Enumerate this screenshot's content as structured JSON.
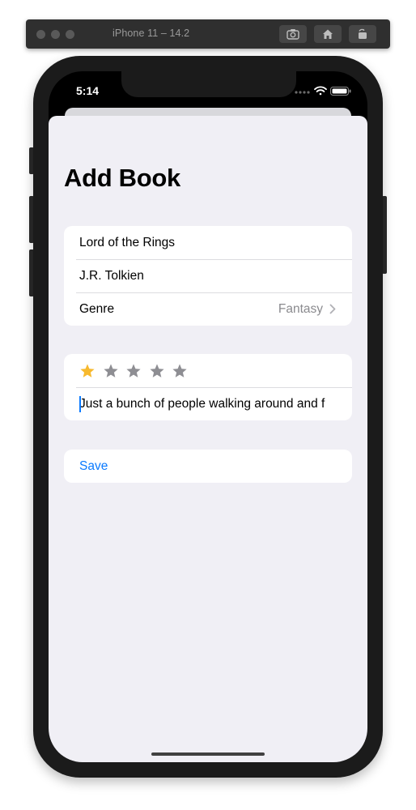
{
  "simulator": {
    "title": "iPhone 11 – 14.2",
    "buttons": [
      {
        "icon": "screenshot-icon"
      },
      {
        "icon": "home-icon"
      },
      {
        "icon": "rotate-icon"
      }
    ]
  },
  "status_bar": {
    "time": "5:14",
    "icons": [
      "signal-dots-icon",
      "wifi-icon",
      "battery-icon"
    ]
  },
  "form": {
    "title": "Add Book",
    "book_title": "Lord of the Rings",
    "author": "J.R. Tolkien",
    "genre_label": "Genre",
    "genre_value": "Fantasy",
    "rating": 1,
    "rating_max": 5,
    "review_text": "Just a bunch of people walking around and f",
    "save_label": "Save"
  },
  "colors": {
    "accent": "#0a7aff",
    "star_filled": "#f7b92e",
    "star_empty": "#8e8e93",
    "sheet_background": "#f0eff5"
  }
}
